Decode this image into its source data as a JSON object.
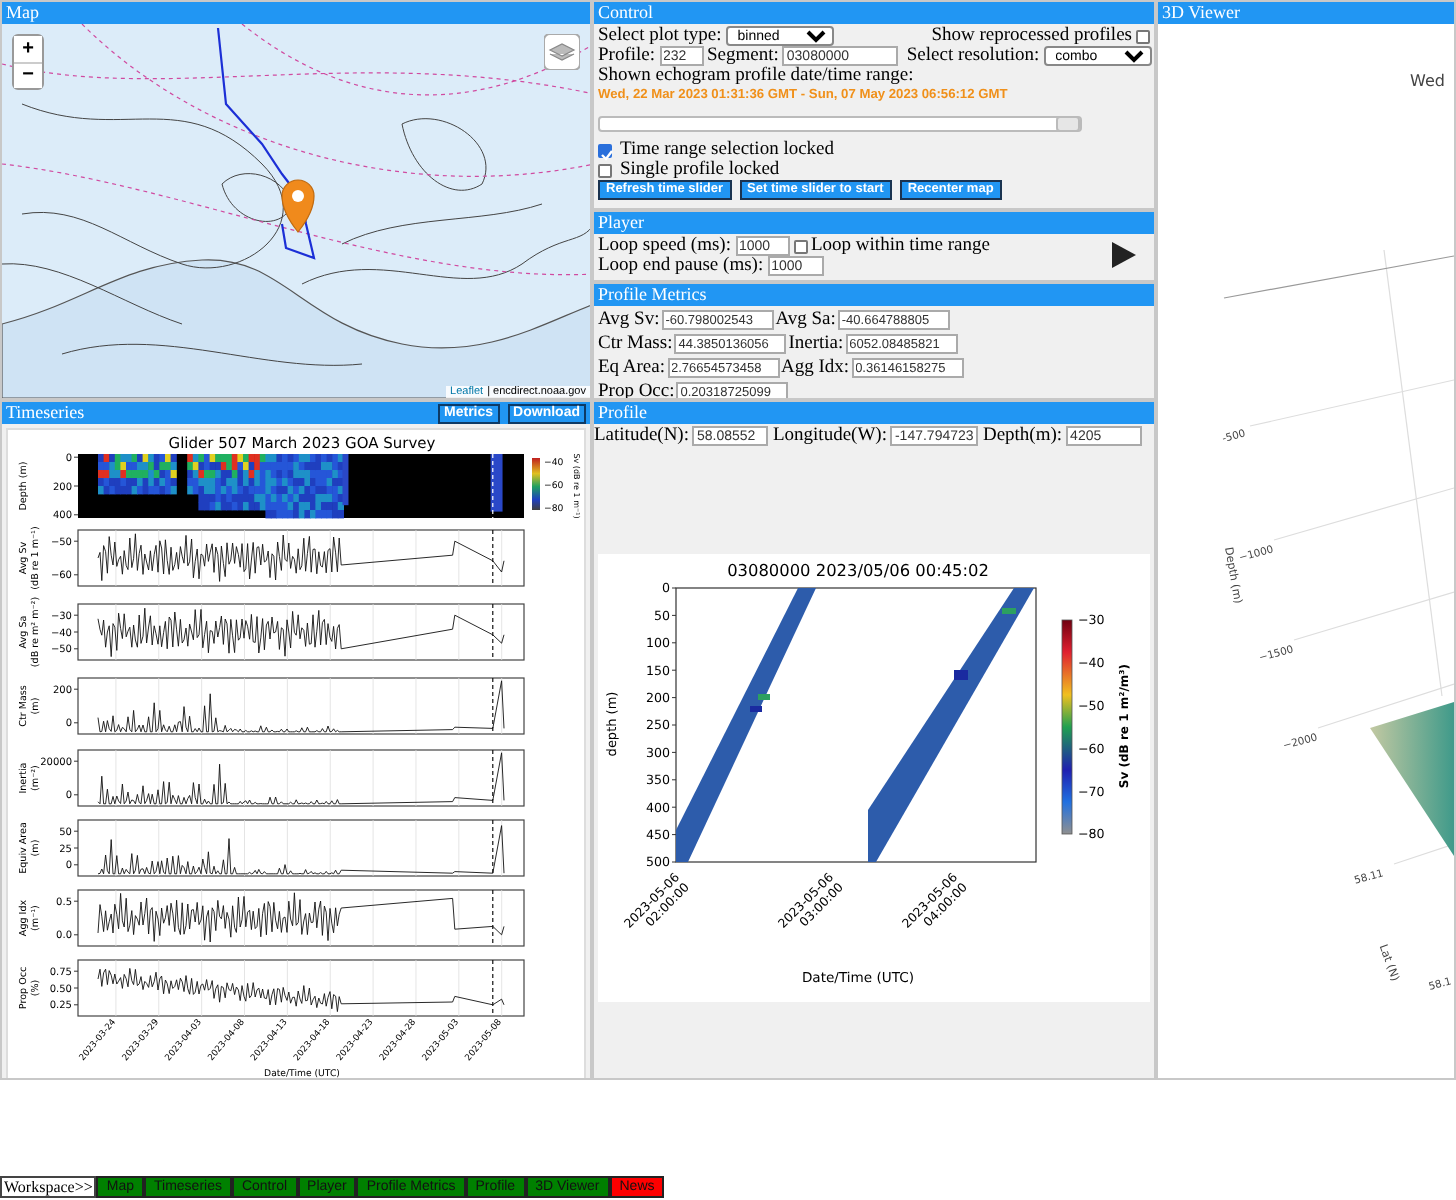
{
  "map": {
    "title": "Map",
    "zoom_in": "+",
    "zoom_out": "−",
    "attribution_link": "Leaflet",
    "attribution_source": "| encdirect.noaa.gov"
  },
  "timeseries": {
    "title": "Timeseries",
    "buttons": [
      "Metrics",
      "Download"
    ],
    "figure": {
      "title": "Glider 507 March 2023 GOA Survey",
      "echogram": {
        "ylabel": [
          "Depth (m)"
        ],
        "yticks": [
          "0",
          "200",
          "400"
        ],
        "colorbar_ticks": [
          "−40",
          "−60",
          "−80"
        ],
        "colorbar_label": "Sv (dB re 1 m⁻¹)"
      },
      "panels": [
        {
          "ylabel": [
            "Avg Sv",
            "(dB re 1 m⁻¹)"
          ],
          "yticks": [
            "−50",
            "−60"
          ]
        },
        {
          "ylabel": [
            "Avg Sa",
            "(dB re m² m⁻²)"
          ],
          "yticks": [
            "−30",
            "−40",
            "−50"
          ]
        },
        {
          "ylabel": [
            "Ctr Mass",
            "(m)"
          ],
          "yticks": [
            "200",
            "0"
          ]
        },
        {
          "ylabel": [
            "Inertia",
            "(m⁻²)"
          ],
          "yticks": [
            "20000",
            "0"
          ]
        },
        {
          "ylabel": [
            "Equiv Area",
            "(m)"
          ],
          "yticks": [
            "50",
            "25",
            "0"
          ]
        },
        {
          "ylabel": [
            "Agg Idx",
            "(m⁻¹)"
          ],
          "yticks": [
            "0.5",
            "0.0"
          ]
        },
        {
          "ylabel": [
            "Prop Occ",
            "(%)"
          ],
          "yticks": [
            "0.75",
            "0.50",
            "0.25"
          ]
        }
      ],
      "xticks": [
        "2023-03-24",
        "2023-03-29",
        "2023-04-03",
        "2023-04-08",
        "2023-04-13",
        "2023-04-18",
        "2023-04-23",
        "2023-04-28",
        "2023-05-03",
        "2023-05-08"
      ],
      "xlabel": "Date/Time (UTC)"
    }
  },
  "control": {
    "title": "Control",
    "plot_type_label": "Select plot type:",
    "plot_type": "binned",
    "show_reprocessed": {
      "label": "Show reprocessed profiles",
      "checked": false
    },
    "profile_label": "Profile:",
    "profile": "232",
    "segment_label": "Segment:",
    "segment": "03080000",
    "resolution_label": "Select resolution:",
    "resolution": "combo",
    "range_label": "Shown echogram profile date/time range:",
    "range": "Wed, 22 Mar 2023 01:31:36 GMT - Sun, 07 May 2023 06:56:12 GMT",
    "time_slider": {
      "level": 1
    },
    "checkboxes": [
      {
        "label": "Time range selection locked",
        "checked": true
      },
      {
        "label": "Single profile locked",
        "checked": false
      }
    ],
    "buttons": [
      "Refresh time slider",
      "Set time slider to start",
      "Recenter map"
    ]
  },
  "player": {
    "title": "Player",
    "loop_speed_label": "Loop speed (ms):",
    "loop_speed": "1000",
    "loop_within": {
      "label": "Loop within time range",
      "checked": false
    },
    "loop_end_pause_label": "Loop end pause (ms):",
    "loop_end_pause": "1000"
  },
  "profile_metrics": {
    "title": "Profile Metrics",
    "rows": [
      [
        {
          "label": "Avg Sv:",
          "value": "-60.798002543"
        },
        {
          "label": "Avg Sa:",
          "value": "-40.664788805"
        }
      ],
      [
        {
          "label": "Ctr Mass:",
          "value": "44.3850136056"
        },
        {
          "label": "Inertia:",
          "value": "6052.08485821"
        }
      ],
      [
        {
          "label": "Eq Area:",
          "value": "2.76654573458"
        },
        {
          "label": "Agg Idx:",
          "value": "0.36146158275"
        }
      ],
      [
        {
          "label": "Prop Occ:",
          "value": "0.20318725099"
        }
      ]
    ]
  },
  "profile": {
    "title": "Profile",
    "fields": [
      {
        "label": "Latitude(N):",
        "value": "58.08552"
      },
      {
        "label": "Longitude(W):",
        "value": "-147.794723"
      },
      {
        "label": "Depth(m):",
        "value": "4205"
      }
    ],
    "figure": {
      "title": "03080000 2023/05/06 00:45:02",
      "ylabel": "depth (m)",
      "yticks": [
        "0",
        "50",
        "100",
        "150",
        "200",
        "250",
        "300",
        "350",
        "400",
        "450",
        "500"
      ],
      "xticks": [
        [
          "2023-05-06",
          "02:00:00"
        ],
        [
          "2023-05-06",
          "03:00:00"
        ],
        [
          "2023-05-06",
          "04:00:00"
        ]
      ],
      "xlabel": "Date/Time (UTC)",
      "colorbar_ticks": [
        "−30",
        "−40",
        "−50",
        "−60",
        "−70",
        "−80"
      ],
      "colorbar_label": "Sv (dB re 1 m²/m³)"
    }
  },
  "viewer3d": {
    "title": "3D Viewer",
    "plot_title": "Wed",
    "zticks": [
      "-500",
      "−1000",
      "−1500",
      "−2000"
    ],
    "zlabel": "Depth (m)",
    "yticks": [
      "58.11",
      "58.1"
    ],
    "ylabel": "Lat (N)"
  },
  "workspace": {
    "label": "Workspace>>",
    "items": [
      {
        "label": "Map",
        "color": "#008000"
      },
      {
        "label": "Timeseries",
        "color": "#008000"
      },
      {
        "label": "Control",
        "color": "#008000"
      },
      {
        "label": "Player",
        "color": "#008000"
      },
      {
        "label": "Profile Metrics",
        "color": "#008000"
      },
      {
        "label": "Profile",
        "color": "#008000"
      },
      {
        "label": "3D Viewer",
        "color": "#008000"
      },
      {
        "label": "News",
        "color": "#ff0000"
      }
    ]
  }
}
